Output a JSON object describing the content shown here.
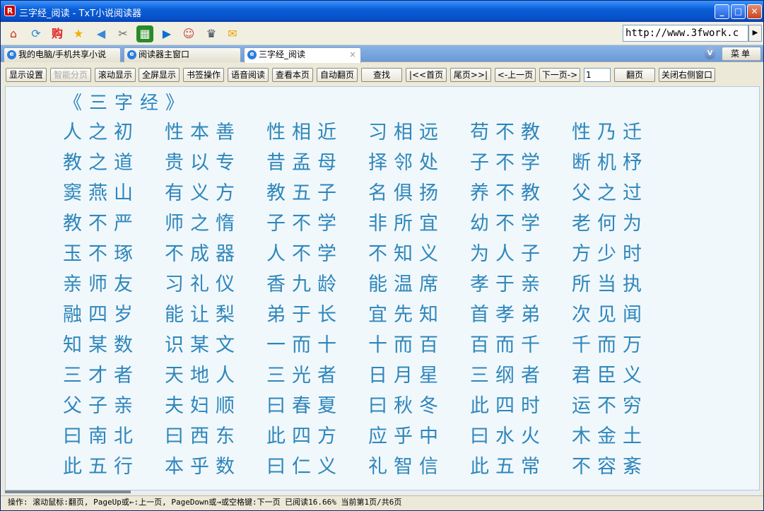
{
  "window": {
    "title": "三字经_阅读 - TxT小说阅读器",
    "app_icon": "R"
  },
  "toolbar": {
    "icons": [
      "home-icon",
      "refresh-icon",
      "shop-icon",
      "star-icon",
      "back-icon",
      "tools-icon",
      "image-icon",
      "play-icon",
      "avatar-icon",
      "photo-icon",
      "chat-icon"
    ],
    "url": "http://www.3fwork.c"
  },
  "tabs": [
    {
      "label": "我的电脑/手机共享小说"
    },
    {
      "label": "阅读器主窗口"
    },
    {
      "label": "三字经_阅读",
      "close": "×"
    }
  ],
  "tabbar": {
    "v_label": "V",
    "menu_label": "菜单"
  },
  "commands": {
    "display_settings": "显示设置",
    "smart_paging": "智能分页",
    "scroll_display": "滚动显示",
    "full_screen": "全屏显示",
    "bookmark": "书签操作",
    "voice_read": "语音阅读",
    "view_page": "查看本页",
    "auto_page": "自动翻页",
    "search": "查找",
    "first_page": "|<<首页",
    "last_page": "尾页>>|",
    "prev_page": "<-上一页",
    "next_page": "下一页->",
    "page_value": "1",
    "go_page": "翻页",
    "close_right": "关闭右侧窗口"
  },
  "content": {
    "title": "《三字经》",
    "rows": [
      [
        "人之初",
        "性本善",
        "性相近",
        "习相远",
        "苟不教",
        "性乃迁"
      ],
      [
        "教之道",
        "贵以专",
        "昔孟母",
        "择邻处",
        "子不学",
        "断机杼"
      ],
      [
        "窦燕山",
        "有义方",
        "教五子",
        "名俱扬",
        "养不教",
        "父之过"
      ],
      [
        "教不严",
        "师之惰",
        "子不学",
        "非所宜",
        "幼不学",
        "老何为"
      ],
      [
        "玉不琢",
        "不成器",
        "人不学",
        "不知义",
        "为人子",
        "方少时"
      ],
      [
        "亲师友",
        "习礼仪",
        "香九龄",
        "能温席",
        "孝于亲",
        "所当执"
      ],
      [
        "融四岁",
        "能让梨",
        "弟于长",
        "宜先知",
        "首孝弟",
        "次见闻"
      ],
      [
        "知某数",
        "识某文",
        "一而十",
        "十而百",
        "百而千",
        "千而万"
      ],
      [
        "三才者",
        "天地人",
        "三光者",
        "日月星",
        "三纲者",
        "君臣义"
      ],
      [
        "父子亲",
        "夫妇顺",
        "曰春夏",
        "曰秋冬",
        "此四时",
        "运不穷"
      ],
      [
        "曰南北",
        "曰西东",
        "此四方",
        "应乎中",
        "曰水火",
        "木金土"
      ],
      [
        "此五行",
        "本乎数",
        "曰仁义",
        "礼智信",
        "此五常",
        "不容紊"
      ]
    ]
  },
  "status": {
    "text": "操作: 滚动鼠标:翻页, PageUp或←:上一页, PageDown或→或空格键:下一页 已阅读16.66% 当前第1页/共6页"
  }
}
